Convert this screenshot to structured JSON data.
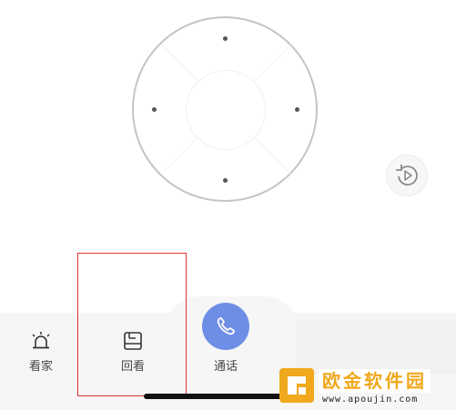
{
  "bottom_nav": {
    "tabs": [
      {
        "label": "看家",
        "icon": "alarm-icon"
      },
      {
        "label": "回看",
        "icon": "playback-icon"
      },
      {
        "label": "通话",
        "icon": "phone-icon"
      }
    ]
  },
  "controls": {
    "ptz_dpad": "direction-control",
    "replay_icon": "replay-icon"
  },
  "colors": {
    "call_button": "#6e8ee6",
    "highlight_border": "#d33333",
    "watermark": "#f0a81c"
  },
  "watermark": {
    "title": "欧金软件园",
    "url": "www.apoujin.com"
  }
}
